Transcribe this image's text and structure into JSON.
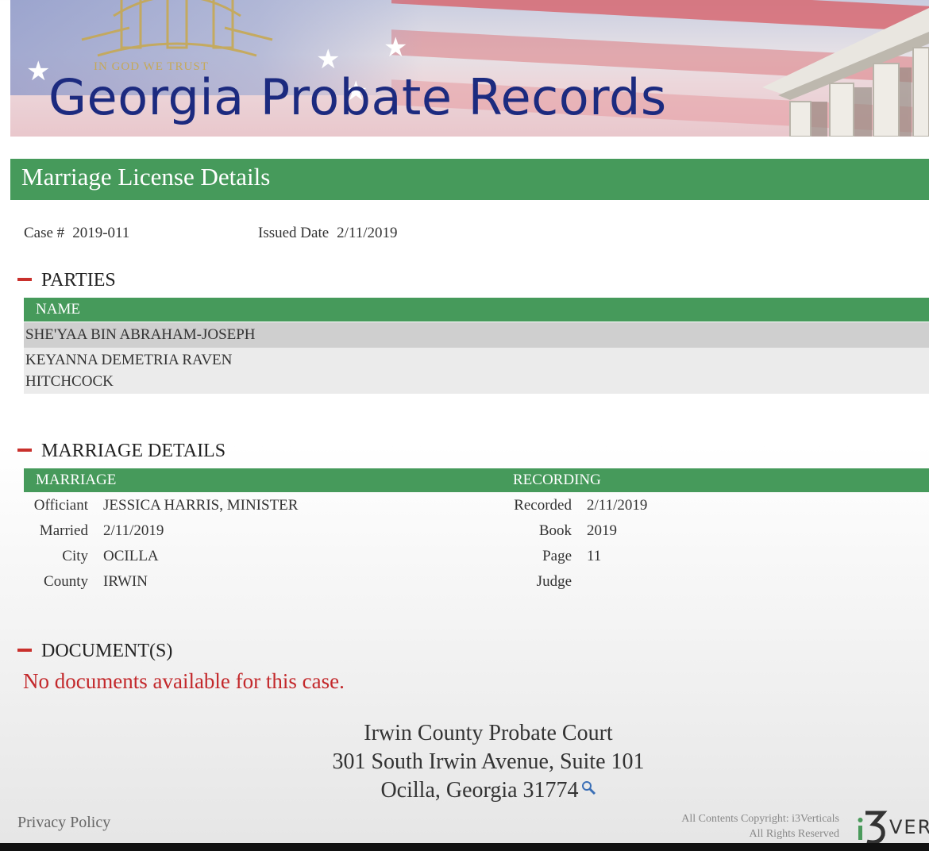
{
  "banner": {
    "title": "Georgia Probate Records",
    "motto": "IN GOD WE TRUST"
  },
  "header": {
    "title": "Marriage License Details"
  },
  "case": {
    "case_label": "Case #",
    "case_value": "2019-011",
    "issued_label": "Issued Date",
    "issued_value": "2/11/2019"
  },
  "parties": {
    "section_title": "PARTIES",
    "column_header": "NAME",
    "rows": [
      {
        "name": "SHE'YAA BIN ABRAHAM-JOSEPH"
      },
      {
        "name_line1": "KEYANNA DEMETRIA RAVEN",
        "name_line2": "HITCHCOCK"
      }
    ]
  },
  "marriage_details": {
    "section_title": "MARRIAGE DETAILS",
    "marriage_header": "MARRIAGE",
    "recording_header": "RECORDING",
    "marriage": [
      {
        "label": "Officiant",
        "value": "JESSICA HARRIS, MINISTER"
      },
      {
        "label": "Married",
        "value": "2/11/2019"
      },
      {
        "label": "City",
        "value": "OCILLA"
      },
      {
        "label": "County",
        "value": "IRWIN"
      }
    ],
    "recording": [
      {
        "label": "Recorded",
        "value": "2/11/2019"
      },
      {
        "label": "Book",
        "value": "2019"
      },
      {
        "label": "Page",
        "value": "11"
      },
      {
        "label": "Judge",
        "value": ""
      }
    ]
  },
  "documents": {
    "section_title": "DOCUMENT(S)",
    "message": "No documents available for this case."
  },
  "footer": {
    "court_name": "Irwin County Probate Court",
    "address_line": "301 South Irwin Avenue, Suite 101",
    "city_line": "Ocilla, Georgia 31774",
    "privacy_link": "Privacy Policy",
    "copyright_line1": "All Contents Copyright: i3Verticals",
    "copyright_line2": "All Rights Reserved",
    "logo_text": "VER"
  },
  "colors": {
    "green": "#469a5b",
    "title_blue": "#1c2a7f",
    "red": "#c3282b"
  },
  "icons": [
    "map-search-icon",
    "collapse-dash-icon"
  ]
}
